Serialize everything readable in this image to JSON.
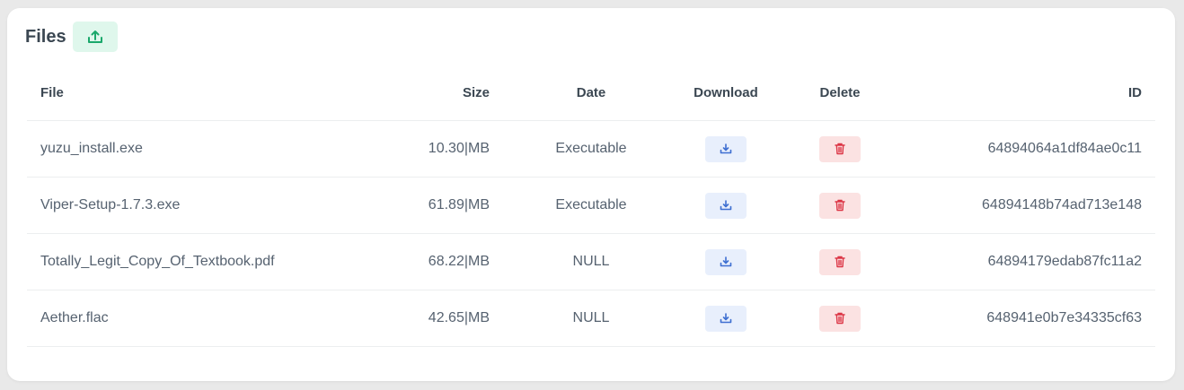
{
  "header": {
    "title": "Files",
    "upload_icon": "upload-icon"
  },
  "table": {
    "columns": [
      "File",
      "Size",
      "Date",
      "Download",
      "Delete",
      "ID"
    ],
    "rows": [
      {
        "file": "yuzu_install.exe",
        "size": "10.30|MB",
        "date": "Executable",
        "id": "64894064a1df84ae0c11"
      },
      {
        "file": "Viper-Setup-1.7.3.exe",
        "size": "61.89|MB",
        "date": "Executable",
        "id": "64894148b74ad713e148"
      },
      {
        "file": "Totally_Legit_Copy_Of_Textbook.pdf",
        "size": "68.22|MB",
        "date": "NULL",
        "id": "64894179edab87fc11a2"
      },
      {
        "file": "Aether.flac",
        "size": "42.65|MB",
        "date": "NULL",
        "id": "648941e0b7e34335cf63"
      }
    ]
  },
  "colors": {
    "upload_accent": "#1aa86b",
    "download_accent": "#3e6fd1",
    "delete_accent": "#dc3545"
  },
  "icons": {
    "download": "download-icon",
    "delete": "trash-icon"
  }
}
